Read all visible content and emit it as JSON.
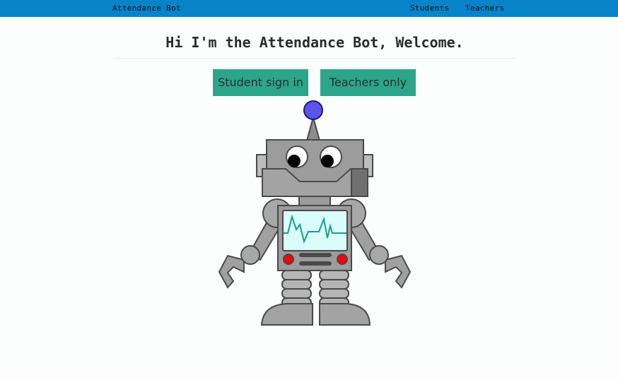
{
  "nav": {
    "brand": "Attendance Bot",
    "links": [
      "Students",
      "Teachers"
    ]
  },
  "main": {
    "title": "Hi I'm the Attendance Bot, Welcome.",
    "buttons": [
      "Student sign in",
      "Teachers only"
    ]
  },
  "colors": {
    "navbar": "#0783c9",
    "button": "#2ca58a"
  },
  "image": {
    "icon": "robot-illustration"
  }
}
